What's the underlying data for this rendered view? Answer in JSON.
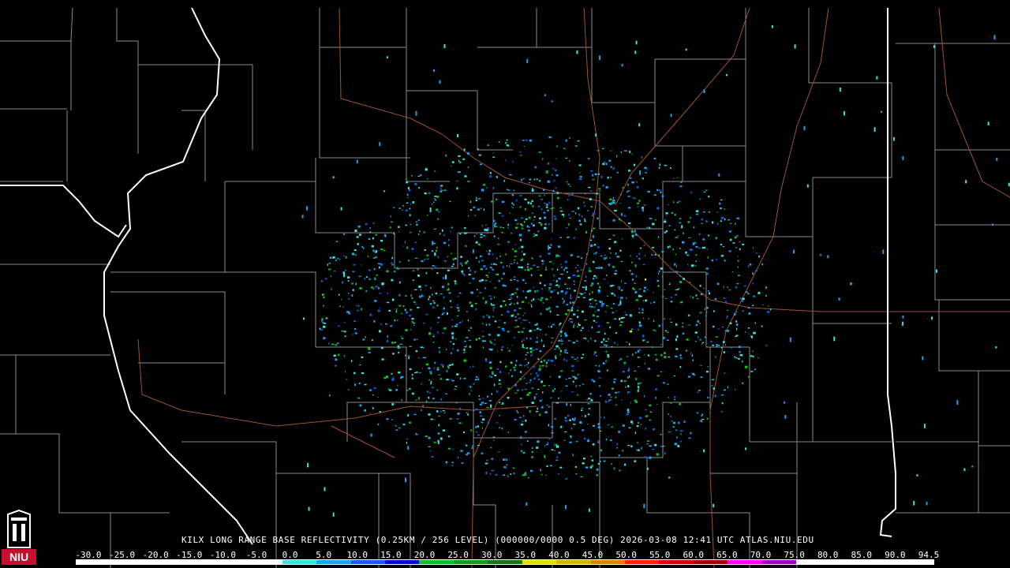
{
  "product": {
    "title": "KILX LONG RANGE BASE REFLECTIVITY (0.25KM / 256 LEVEL) (000000/0000 0.5 DEG) 2026-03-08 12:41 UTC  ATLAS.NIU.EDU",
    "logo_text": "NIU"
  },
  "legend": {
    "labels": [
      "-30.0",
      "-25.0",
      "-20.0",
      "-15.0",
      "-10.0",
      "-5.0",
      "0.0",
      "5.0",
      "10.0",
      "15.0",
      "20.0",
      "25.0",
      "30.0",
      "35.0",
      "40.0",
      "45.0",
      "50.0",
      "55.0",
      "60.0",
      "65.0",
      "70.0",
      "75.0",
      "80.0",
      "85.0",
      "90.0",
      "94.5"
    ],
    "colors": [
      "#ffffff",
      "#ffffff",
      "#ffffff",
      "#ffffff",
      "#ffffff",
      "#ffffff",
      "#40e0e0",
      "#20a0f0",
      "#1060e0",
      "#0010c0",
      "#10c020",
      "#10a010",
      "#0c7a0c",
      "#e0e000",
      "#d8b000",
      "#e08000",
      "#ff2000",
      "#d00000",
      "#a00000",
      "#ff00ff",
      "#a000c0",
      "#ffffff",
      "#ffffff",
      "#ffffff",
      "#ffffff"
    ]
  },
  "colors": {
    "background": "#000000",
    "county_lines": "#8c8c8c",
    "state_lines": "#ffffff",
    "highways": "#a0522d"
  }
}
